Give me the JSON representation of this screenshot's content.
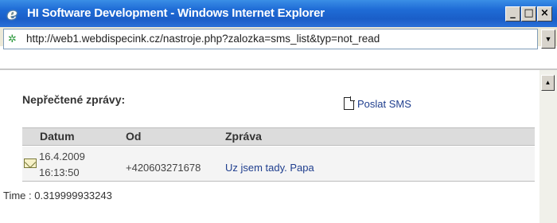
{
  "window": {
    "title": "HI Software Development - Windows Internet Explorer",
    "app_icon": "ie-icon",
    "controls": [
      "minimize",
      "maximize",
      "close"
    ]
  },
  "address": {
    "url": "http://web1.webdispecink.cz/nastroje.php?zalozka=sms_list&typ=not_read"
  },
  "page": {
    "heading": "Nepřečtené zprávy:",
    "send_sms_label": "Poslat SMS",
    "table": {
      "columns": [
        "Datum",
        "Od",
        "Zpráva"
      ],
      "rows": [
        {
          "date": "16.4.2009",
          "time": "16:13:50",
          "from": "+420603271678",
          "message": "Uz jsem tady. Papa"
        }
      ]
    },
    "time_label": "Time : 0.319999933243"
  },
  "colors": {
    "titlebar": "#1f6cd6",
    "link": "#1f3e8e",
    "header_bg": "#dcdcdc"
  }
}
